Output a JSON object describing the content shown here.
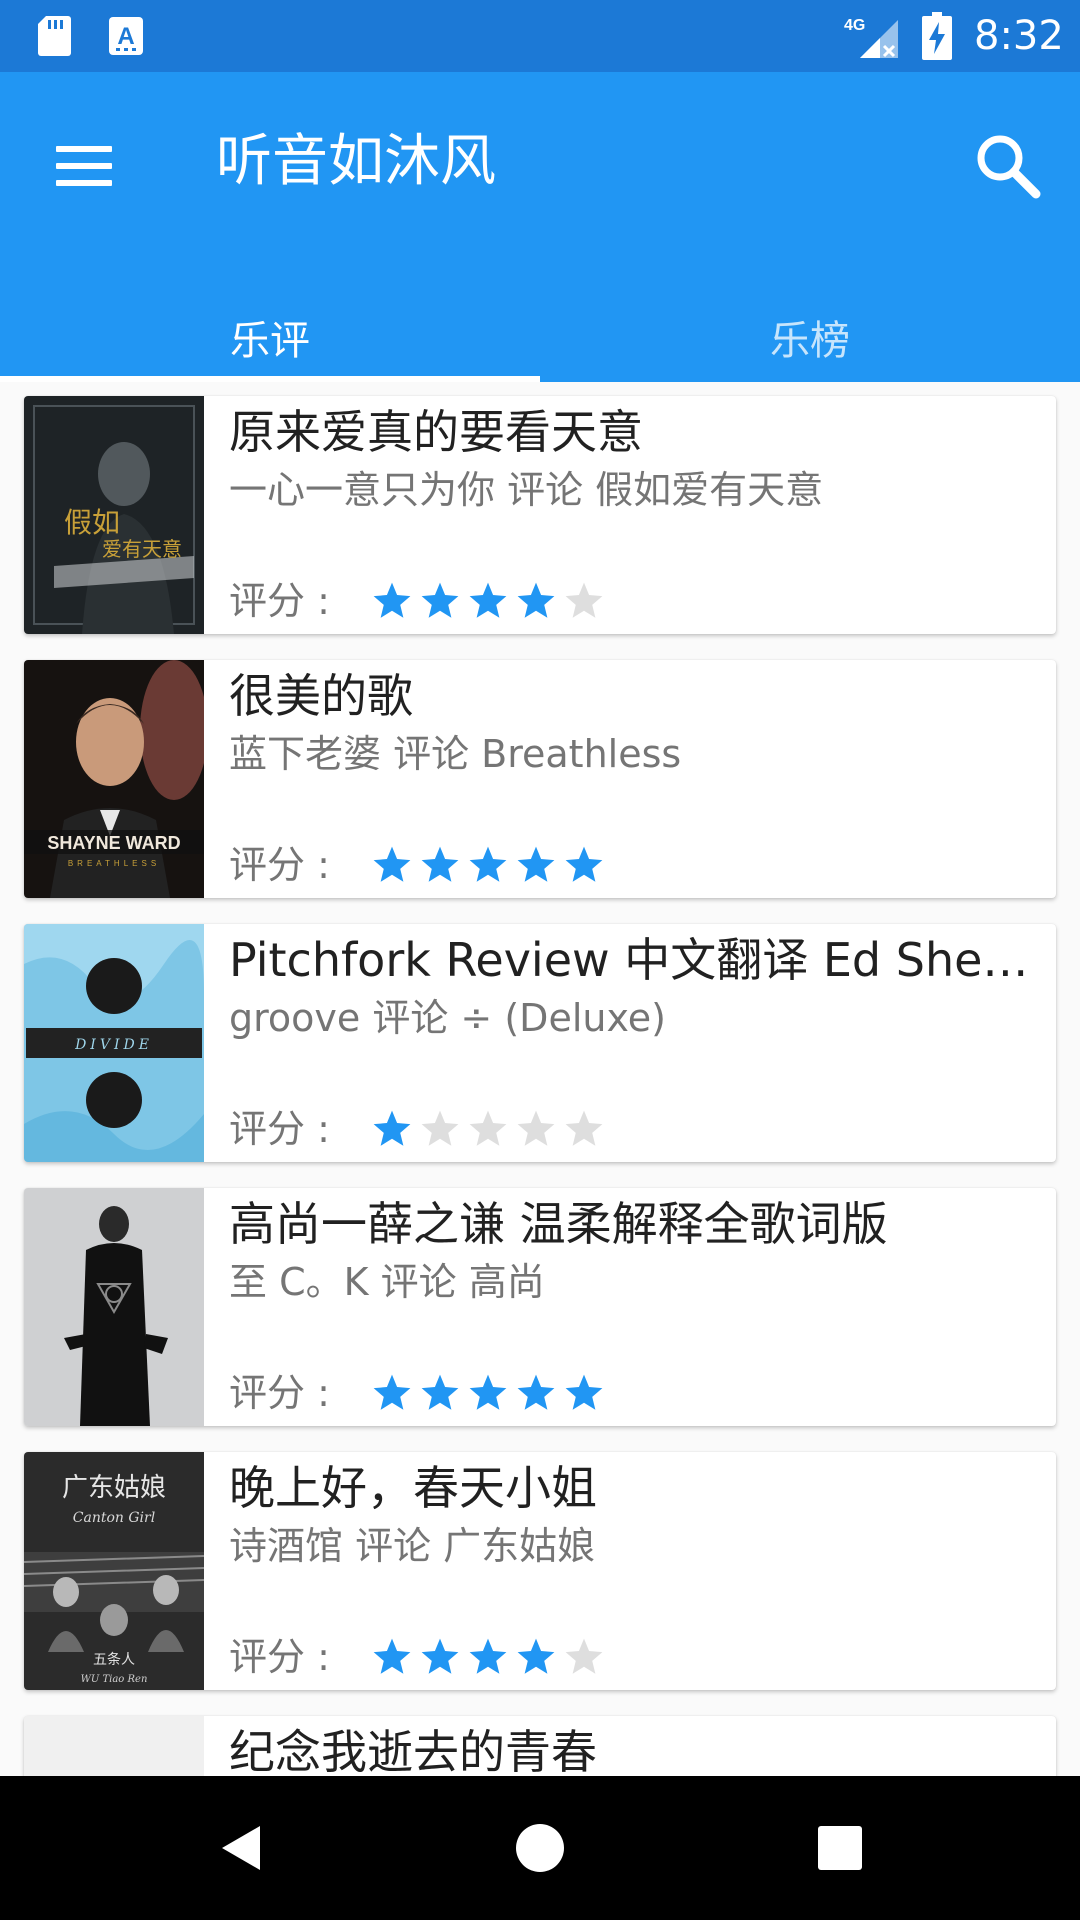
{
  "status_bar": {
    "time": "8:32",
    "network": "4G",
    "icons": [
      "sd-card-icon",
      "ime-a-icon",
      "signal-4g-icon",
      "battery-charging-icon"
    ]
  },
  "app_bar": {
    "title": "听音如沐风",
    "menu_icon": "hamburger-menu-icon",
    "search_icon": "search-icon",
    "color": "#2196f3",
    "status_color": "#1c79d6"
  },
  "tabs": [
    {
      "label": "乐评",
      "selected": true
    },
    {
      "label": "乐榜",
      "selected": false
    }
  ],
  "reviews": [
    {
      "title": "原来爱真的要看天意",
      "subtitle": "一心一意只为你 评论 假如爱有天意",
      "rating_label": "评分 :",
      "rating": 4,
      "max_rating": 5,
      "cover_text": [
        "假如",
        "爱有天意"
      ]
    },
    {
      "title": "很美的歌",
      "subtitle": "蓝下老婆 评论 Breathless",
      "rating_label": "评分 :",
      "rating": 5,
      "max_rating": 5,
      "cover_text": [
        "SHAYNE WARD",
        "BREATHLESS"
      ]
    },
    {
      "title": "Pitchfork Review 中文翻译 Ed Sheer...",
      "subtitle": "groove 评论 ÷ (Deluxe)",
      "rating_label": "评分 :",
      "rating": 1,
      "max_rating": 5,
      "cover_text": [
        "DIVIDE"
      ]
    },
    {
      "title": "高尚一薛之谦 温柔解释全歌词版",
      "subtitle": "至 C。K 评论 高尚",
      "rating_label": "评分 :",
      "rating": 5,
      "max_rating": 5,
      "cover_text": []
    },
    {
      "title": "晚上好，春天小姐",
      "subtitle": "诗酒馆 评论 广东姑娘",
      "rating_label": "评分 :",
      "rating": 4,
      "max_rating": 5,
      "cover_text": [
        "广东姑娘",
        "Canton Girl",
        "五条人",
        "WU Tiao Ren"
      ]
    },
    {
      "title": "纪念我逝去的青春",
      "subtitle": "",
      "rating_label": "",
      "rating": 0,
      "max_rating": 5,
      "cover_text": []
    }
  ],
  "colors": {
    "star_filled": "#2196f3",
    "star_empty": "#dedede",
    "title_text": "#212121",
    "secondary_text": "#757575"
  },
  "nav_bar": {
    "icons": [
      "back-icon",
      "home-icon",
      "recents-icon"
    ]
  }
}
